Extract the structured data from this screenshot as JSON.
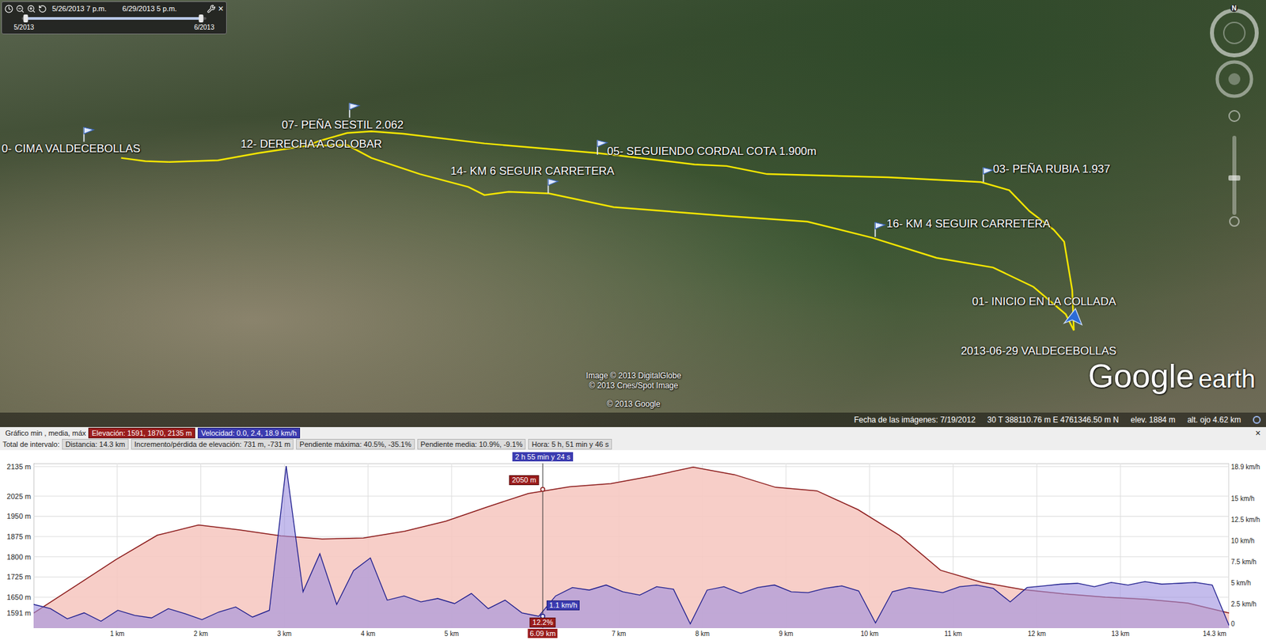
{
  "time_slider": {
    "start_label": "5/26/2013 7 p.m.",
    "end_label": "6/29/2013 5 p.m.",
    "range_start_label": "5/2013",
    "range_end_label": "6/2013",
    "range_start": 0.02,
    "range_end": 0.97,
    "close": "×"
  },
  "map": {
    "placemarks": [
      {
        "label": "0- CIMA VALDECEBOLLAS",
        "kind": "flag"
      },
      {
        "label": "12- DERECHA A GOLOBAR",
        "kind": "none"
      },
      {
        "label": "07- PEÑA SESTIL 2.062",
        "kind": "flag"
      },
      {
        "label": "05- SEGUIENDO CORDAL COTA 1.900m",
        "kind": "flag"
      },
      {
        "label": "14- KM 6 SEGUIR CARRETERA",
        "kind": "flag"
      },
      {
        "label": "03- PEÑA RUBIA 1.937",
        "kind": "flag"
      },
      {
        "label": "16- KM 4 SEGUIR CARRETERA",
        "kind": "flag"
      },
      {
        "label": "01- INICIO EN LA COLLADA",
        "kind": "start"
      }
    ],
    "track_title": "2013-06-29 VALDECEBOLLAS",
    "compass": "N",
    "credits": [
      "Image © 2013 DigitalGlobe",
      "© 2013 Cnes/Spot Image",
      "© 2013 Google"
    ],
    "logo": [
      "Google",
      "earth"
    ],
    "status_bar": [
      "Fecha de las imágenes: 7/19/2012",
      "30 T 388110.76 m E 4761346.50 m N",
      "elev. 1884 m",
      "alt. ojo 4.62 km"
    ]
  },
  "profile": {
    "close": "×",
    "summary_label": "Gráfico min , media, máx",
    "elevation_summary": "Elevación: 1591, 1870, 2135 m",
    "speed_summary": "Velocidad: 0.0, 2.4, 18.9 km/h",
    "totals_label": "Total de intervalo:",
    "totals": [
      "Distancia: 14.3 km",
      "Incremento/pérdida de elevación: 731 m, -731 m",
      "Pendiente máxima: 40.5%, -35.1%",
      "Pendiente media: 10.9%, -9.1%",
      "Hora: 5 h, 51 min y 46 s"
    ],
    "elevation_ticks": [
      "2135 m",
      "2025 m",
      "1950 m",
      "1875 m",
      "1800 m",
      "1725 m",
      "1650 m",
      "1591 m"
    ],
    "speed_ticks": [
      "18.9 km/h",
      "15 km/h",
      "12.5 km/h",
      "10 km/h",
      "7.5 km/h",
      "5 km/h",
      "2.5 km/h",
      "0"
    ],
    "distance_ticks": [
      "1 km",
      "2 km",
      "3 km",
      "4 km",
      "5 km",
      "7 km",
      "8 km",
      "9 km",
      "10 km",
      "11 km",
      "12 km",
      "13 km",
      "14.3 km"
    ],
    "elevation_m": [
      1591,
      1690,
      1790,
      1880,
      1918,
      1900,
      1878,
      1866,
      1870,
      1895,
      1932,
      1985,
      2035,
      2060,
      2072,
      2100,
      2133,
      2105,
      2058,
      2045,
      1975,
      1880,
      1750,
      1705,
      1678,
      1662,
      1650,
      1642,
      1628,
      1591
    ],
    "speed_kmh": [
      2.5,
      2.0,
      0.8,
      1.5,
      0.5,
      1.8,
      1.2,
      0.9,
      2.0,
      1.4,
      0.7,
      1.6,
      2.2,
      1.0,
      1.8,
      18.9,
      4.0,
      8.5,
      2.5,
      6.5,
      8.0,
      3.0,
      3.5,
      2.8,
      3.2,
      2.6,
      3.8,
      2.0,
      3.0,
      1.5,
      1.1,
      3.5,
      4.5,
      4.2,
      4.8,
      4.0,
      3.6,
      4.6,
      4.3,
      0.2,
      4.2,
      4.6,
      3.8,
      4.5,
      4.8,
      4.0,
      3.9,
      4.4,
      4.7,
      4.1,
      0.3,
      4.0,
      4.5,
      4.2,
      3.9,
      4.6,
      4.8,
      4.4,
      2.8,
      4.5,
      4.7,
      4.9,
      5.0,
      4.6,
      5.1,
      4.8,
      5.2,
      4.9,
      5.0,
      5.1,
      4.8,
      0.0
    ],
    "cursor": {
      "distance": "6.09 km",
      "elevation": "2050 m",
      "speed": "1.1 km/h",
      "slope": "12.2%",
      "time": "2 h 55 min y 24 s"
    }
  }
}
